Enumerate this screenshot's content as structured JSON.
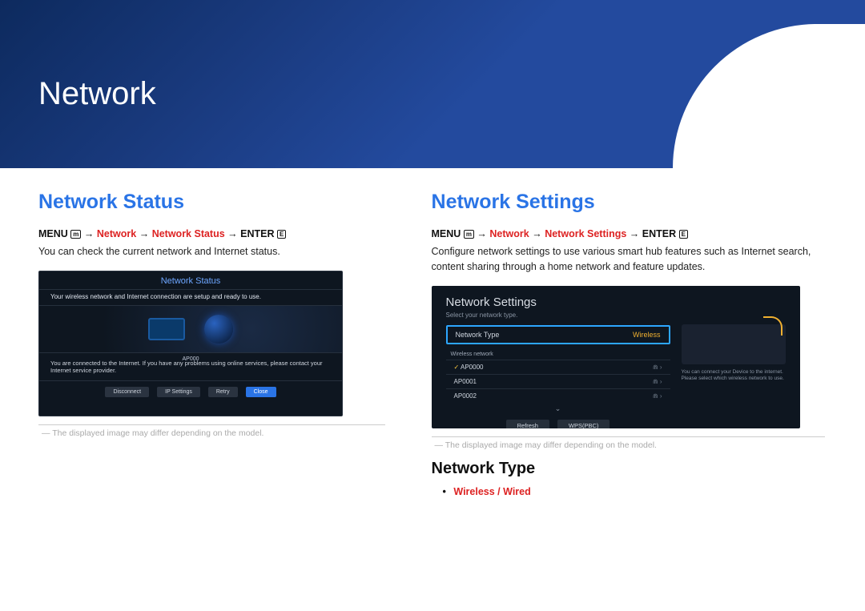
{
  "banner": {
    "title": "Network"
  },
  "left": {
    "heading": "Network Status",
    "path": {
      "prefix": "MENU",
      "icon_menu": "m",
      "arrow": "→",
      "kw1": "Network",
      "kw2": "Network Status",
      "suffix": "ENTER",
      "icon_enter": "E"
    },
    "desc": "You can check the current network and Internet status.",
    "ui": {
      "header": "Network Status",
      "msg1": "Your wireless network and Internet connection are setup and ready to use.",
      "ap": "AP000",
      "msg2": "You are connected to the Internet. If you have any problems using online services, please contact your Internet service provider.",
      "buttons": [
        "Disconnect",
        "IP Settings",
        "Retry",
        "Close"
      ]
    },
    "footnote": "The displayed image may differ depending on the model."
  },
  "right": {
    "heading": "Network Settings",
    "path": {
      "prefix": "MENU",
      "icon_menu": "m",
      "arrow": "→",
      "kw1": "Network",
      "kw2": "Network Settings",
      "suffix": "ENTER",
      "icon_enter": "E"
    },
    "desc": "Configure network settings to use various smart hub features such as Internet search, content sharing through a home network and feature updates.",
    "ui": {
      "title": "Network Settings",
      "sub": "Select your network type.",
      "row_label": "Network Type",
      "row_value": "Wireless",
      "wn_label": "Wireless network",
      "aps": [
        "AP0000",
        "AP0001",
        "AP0002"
      ],
      "actions": [
        "Refresh",
        "WPS(PBC)"
      ],
      "side_text": "You can connect your Device to the internet. Please select which wireless network to use."
    },
    "footnote": "The displayed image may differ depending on the model.",
    "sub_heading": "Network Type",
    "options": {
      "a": "Wireless",
      "sep": " / ",
      "b": "Wired"
    }
  }
}
